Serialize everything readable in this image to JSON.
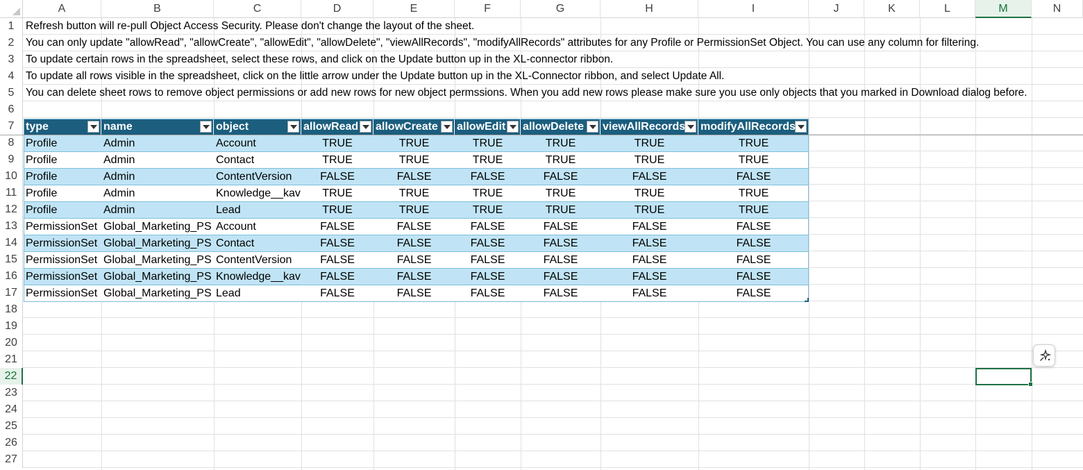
{
  "columns": [
    "A",
    "B",
    "C",
    "D",
    "E",
    "F",
    "G",
    "H",
    "I",
    "J",
    "K",
    "L",
    "M",
    "N"
  ],
  "selected_column": "M",
  "selected_row": "22",
  "rows": [
    "1",
    "2",
    "3",
    "4",
    "5",
    "6",
    "7",
    "8",
    "9",
    "10",
    "11",
    "12",
    "13",
    "14",
    "15",
    "16",
    "17",
    "18",
    "19",
    "20",
    "21",
    "22",
    "23",
    "24",
    "25",
    "26",
    "27"
  ],
  "notes": [
    "Refresh button will re-pull Object Access Security. Please don't change the layout of the sheet.",
    "You can only update \"allowRead\", \"allowCreate\", \"allowEdit\", \"allowDelete\", \"viewAllRecords\", \"modifyAllRecords\" attributes for any Profile or PermissionSet Object. You can use any column for filtering.",
    "To update certain rows in the spreadsheet, select these rows, and click on the Update button up in the XL-connector ribbon.",
    "To update all rows visible in the spreadsheet, click on the little arrow under the Update button up in the XL-Connector ribbon, and select Update All.",
    "You can delete sheet rows to remove object permissions or add new rows for new object permssions. When you add new rows please make sure you use only objects that you marked in Download dialog before."
  ],
  "table": {
    "headers": [
      "type",
      "name",
      "object",
      "allowRead",
      "allowCreate",
      "allowEdit",
      "allowDelete",
      "viewAllRecords",
      "modifyAllRecords"
    ],
    "rows": [
      [
        "Profile",
        "Admin",
        "Account",
        "TRUE",
        "TRUE",
        "TRUE",
        "TRUE",
        "TRUE",
        "TRUE"
      ],
      [
        "Profile",
        "Admin",
        "Contact",
        "TRUE",
        "TRUE",
        "TRUE",
        "TRUE",
        "TRUE",
        "TRUE"
      ],
      [
        "Profile",
        "Admin",
        "ContentVersion",
        "FALSE",
        "FALSE",
        "FALSE",
        "FALSE",
        "FALSE",
        "FALSE"
      ],
      [
        "Profile",
        "Admin",
        "Knowledge__kav",
        "TRUE",
        "TRUE",
        "TRUE",
        "TRUE",
        "TRUE",
        "TRUE"
      ],
      [
        "Profile",
        "Admin",
        "Lead",
        "TRUE",
        "TRUE",
        "TRUE",
        "TRUE",
        "TRUE",
        "TRUE"
      ],
      [
        "PermissionSet",
        "Global_Marketing_PS",
        "Account",
        "FALSE",
        "FALSE",
        "FALSE",
        "FALSE",
        "FALSE",
        "FALSE"
      ],
      [
        "PermissionSet",
        "Global_Marketing_PS",
        "Contact",
        "FALSE",
        "FALSE",
        "FALSE",
        "FALSE",
        "FALSE",
        "FALSE"
      ],
      [
        "PermissionSet",
        "Global_Marketing_PS",
        "ContentVersion",
        "FALSE",
        "FALSE",
        "FALSE",
        "FALSE",
        "FALSE",
        "FALSE"
      ],
      [
        "PermissionSet",
        "Global_Marketing_PS",
        "Knowledge__kav",
        "FALSE",
        "FALSE",
        "FALSE",
        "FALSE",
        "FALSE",
        "FALSE"
      ],
      [
        "PermissionSet",
        "Global_Marketing_PS",
        "Lead",
        "FALSE",
        "FALSE",
        "FALSE",
        "FALSE",
        "FALSE",
        "FALSE"
      ]
    ]
  },
  "colors": {
    "table_header": "#1b5e7e",
    "band": "#c0e4f5",
    "selection": "#1e7145"
  },
  "icons": {
    "filter": "chevron-down-icon",
    "copilot": "sparkle-icon"
  }
}
